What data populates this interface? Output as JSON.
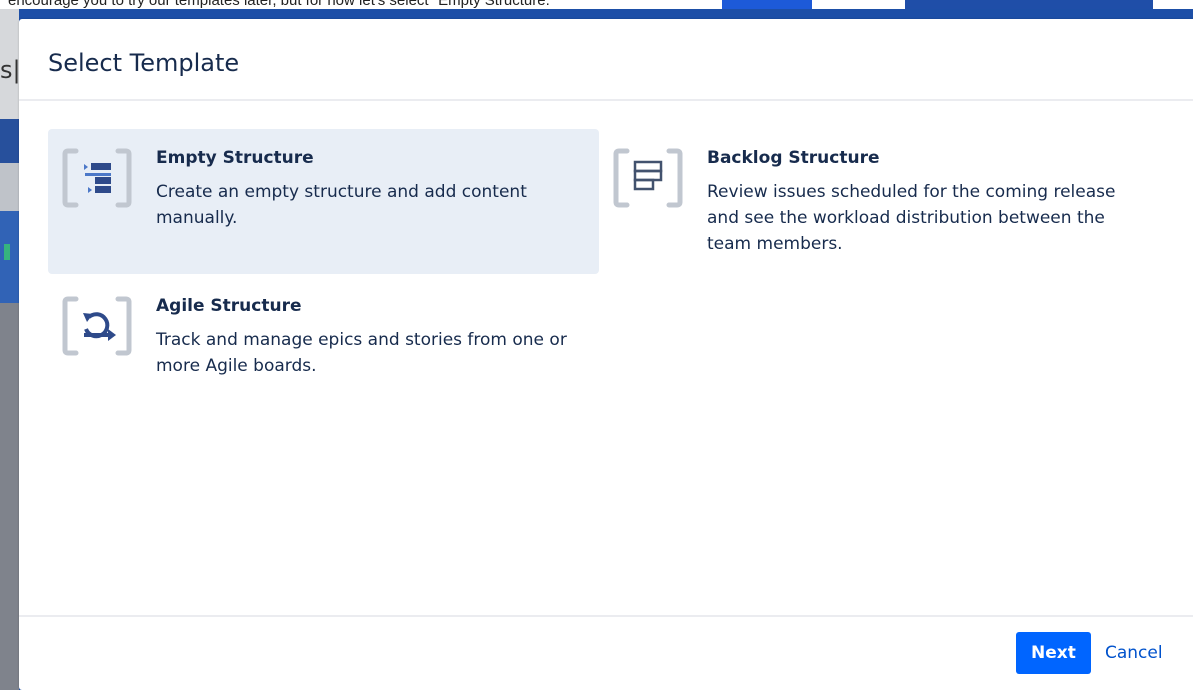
{
  "background": {
    "caption": "encourage you to try our templates later, but for now let's select \"Empty Structure.\"",
    "partial_letter": "s|"
  },
  "modal": {
    "title": "Select Template",
    "templates": [
      {
        "title": "Empty Structure",
        "description": "Create an empty structure and add content manually.",
        "icon": "empty-structure-icon",
        "selected": true
      },
      {
        "title": "Backlog Structure",
        "description": "Review issues scheduled for the coming release and see the workload distribution between the team members.",
        "icon": "backlog-structure-icon",
        "selected": false
      },
      {
        "title": "Agile Structure",
        "description": "Track and manage epics and stories from one or more Agile boards.",
        "icon": "agile-structure-icon",
        "selected": false
      }
    ],
    "footer": {
      "next_label": "Next",
      "cancel_label": "Cancel"
    }
  },
  "colors": {
    "primary": "#0065ff",
    "link": "#0052cc",
    "text": "#172b4d",
    "selected_bg": "#e8eef6",
    "icon_bracket": "#c1c7d0",
    "icon_fill": "#2e4a8a"
  }
}
